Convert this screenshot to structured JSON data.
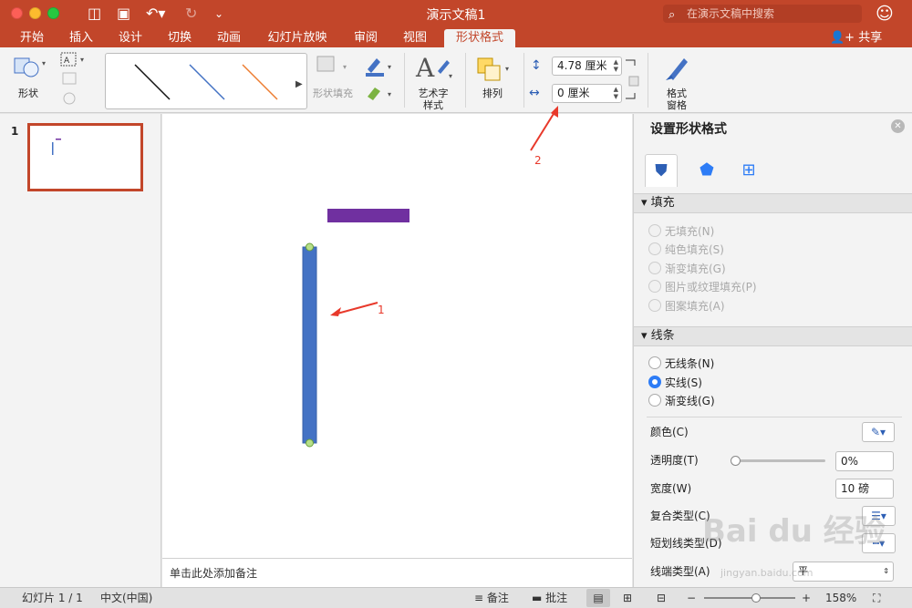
{
  "window": {
    "title": "演示文稿1"
  },
  "search": {
    "placeholder": "在演示文稿中搜索"
  },
  "tabs": [
    {
      "label": "开始"
    },
    {
      "label": "插入"
    },
    {
      "label": "设计"
    },
    {
      "label": "切换"
    },
    {
      "label": "动画"
    },
    {
      "label": "幻灯片放映"
    },
    {
      "label": "审阅"
    },
    {
      "label": "视图"
    },
    {
      "label": "形状格式"
    }
  ],
  "share_label": "共享",
  "ribbon": {
    "shapes_label": "形状",
    "shape_fill_label": "形状填充",
    "wordart_label_1": "艺术字",
    "wordart_label_2": "样式",
    "arrange_label": "排列",
    "height_value": "4.78 厘米",
    "width_value": "0 厘米",
    "format_pane_label_1": "格式",
    "format_pane_label_2": "窗格"
  },
  "thumbnails": {
    "slide_number": "1"
  },
  "annotations": {
    "arrow1": "1",
    "arrow2": "2"
  },
  "notes": {
    "placeholder": "单击此处添加备注"
  },
  "pane": {
    "title": "设置形状格式",
    "fill_section": "填充",
    "fill_options": [
      "无填充(N)",
      "纯色填充(S)",
      "渐变填充(G)",
      "图片或纹理填充(P)",
      "图案填充(A)"
    ],
    "line_section": "线条",
    "line_options": [
      "无线条(N)",
      "实线(S)",
      "渐变线(G)"
    ],
    "color_label": "颜色(C)",
    "transparency_label": "透明度(T)",
    "transparency_value": "0%",
    "width_label": "宽度(W)",
    "width_value": "10 磅",
    "compound_label": "复合类型(C)",
    "dash_label": "短划线类型(D)",
    "cap_label": "线端类型(A)",
    "cap_value": "平"
  },
  "status": {
    "slide": "幻灯片 1 / 1",
    "language": "中文(中国)",
    "notes_btn": "备注",
    "comments_btn": "批注",
    "zoom": "158%"
  },
  "colors": {
    "accent": "#c2462a",
    "line_blue": "#4472c4",
    "bar_purple": "#7030a0",
    "annotation": "#e8392b"
  },
  "watermark": {
    "text": "Bai du 经验",
    "url_text": "jingyan.baidu.com"
  }
}
